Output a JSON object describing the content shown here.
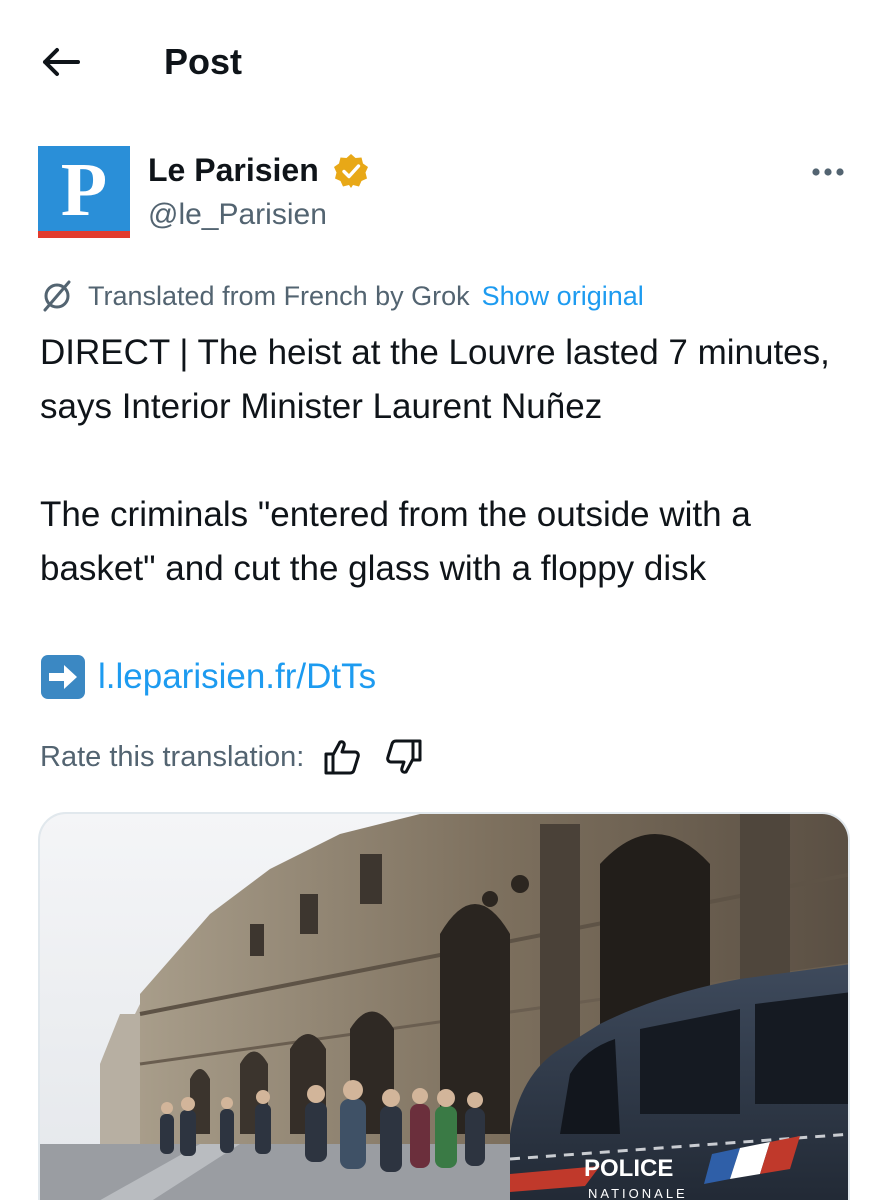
{
  "header": {
    "back_icon": "arrow-left-icon",
    "title": "Post"
  },
  "author": {
    "avatar_letter": "P",
    "avatar_colors": {
      "background": "#2a8fd8",
      "accent": "#e23b2e"
    },
    "name": "Le Parisien",
    "verified_badge": "gold-verified-icon",
    "handle": "@le_Parisien",
    "more_icon": "more-options-icon"
  },
  "translation": {
    "icon": "grok-icon",
    "label": "Translated from French by Grok",
    "show_original": "Show original"
  },
  "post": {
    "paragraph_1": "DIRECT | The heist at the Louvre lasted 7 minutes, says Interior Minister Laurent Nuñez",
    "paragraph_2": "The criminals \"entered from the outside with a basket\" and cut the glass with a floppy disk",
    "link_icon": "right-arrow-emoji-icon",
    "link_text": "l.leparisien.fr/DtTs"
  },
  "rating": {
    "label": "Rate this translation:",
    "thumbs_up_icon": "thumbs-up-icon",
    "thumbs_down_icon": "thumbs-down-icon"
  },
  "media": {
    "van_text_1": "POLICE",
    "van_text_2": "NATIONALE"
  },
  "colors": {
    "text": "#0f1419",
    "secondary": "#536471",
    "link": "#1d9bf0",
    "verified": "#e8a817"
  }
}
